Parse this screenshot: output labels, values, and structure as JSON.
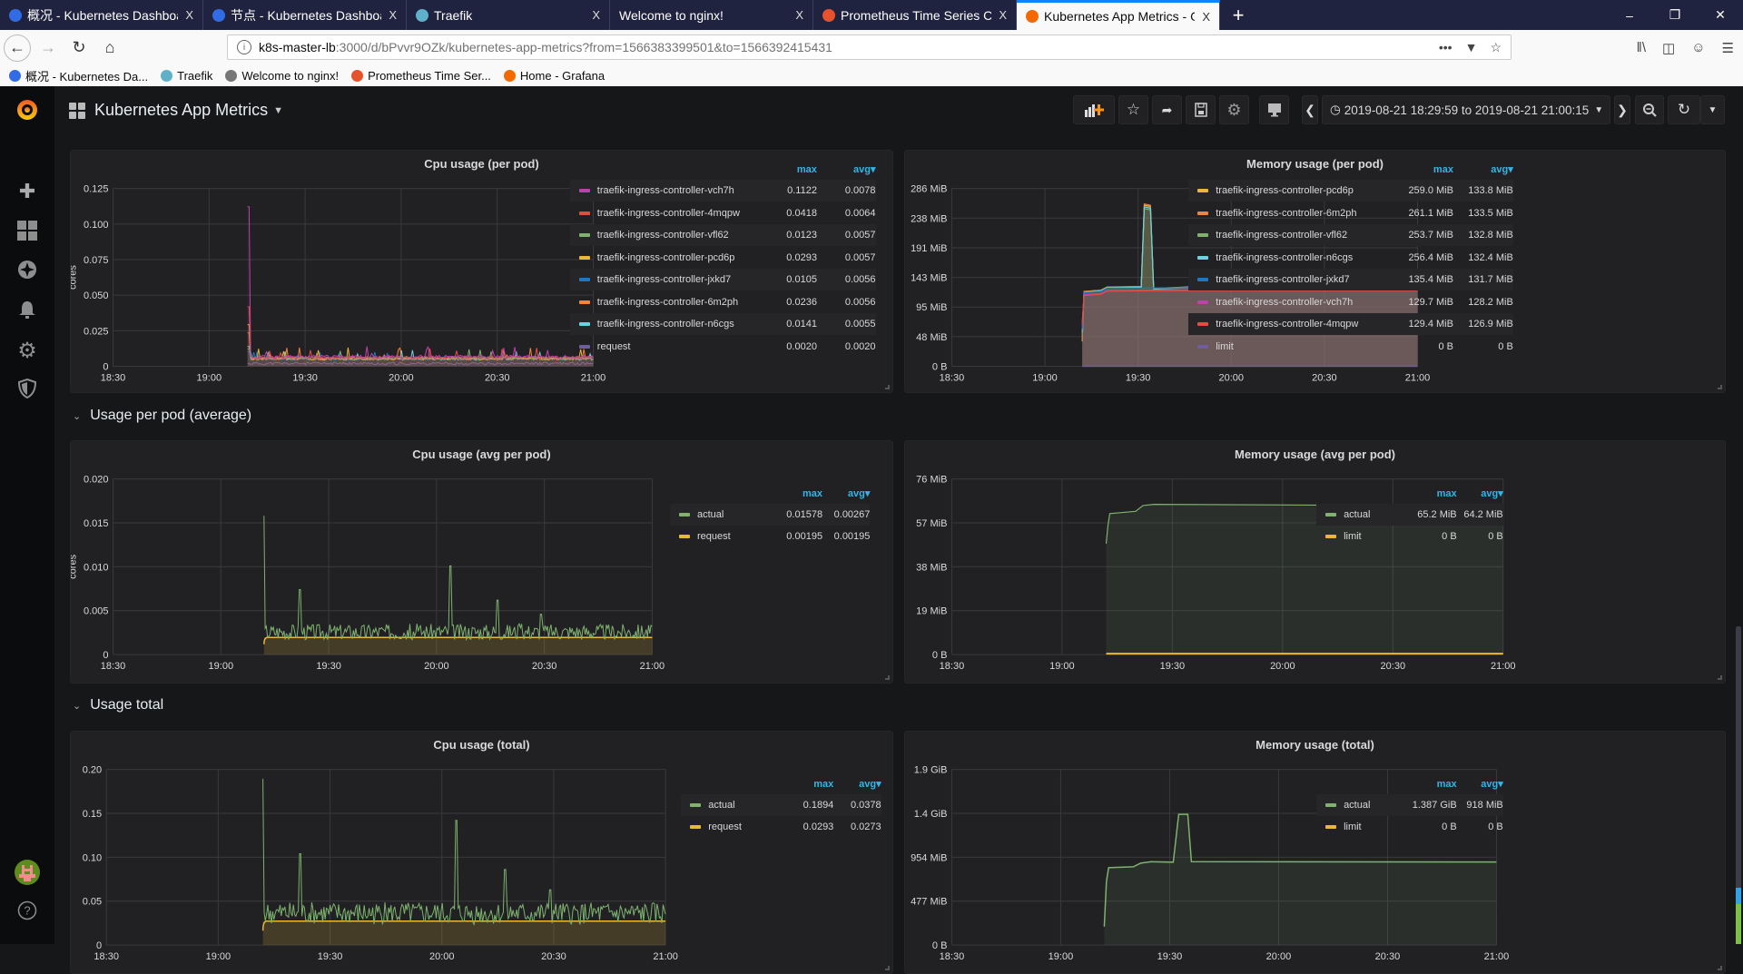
{
  "browser": {
    "tabs": [
      {
        "label": "概况 - Kubernetes Dashboard",
        "icon": "kubernetes-icon",
        "color": "#326ce5",
        "active": false
      },
      {
        "label": "节点 - Kubernetes Dashboard",
        "icon": "kubernetes-icon",
        "color": "#326ce5",
        "active": false
      },
      {
        "label": "Traefik",
        "icon": "traefik-icon",
        "color": "#5fb0c9",
        "active": false
      },
      {
        "label": "Welcome to nginx!",
        "icon": "",
        "color": "",
        "active": false
      },
      {
        "label": "Prometheus Time Series Collection",
        "icon": "prometheus-icon",
        "color": "#e6522c",
        "active": false
      },
      {
        "label": "Kubernetes App Metrics - Grafana",
        "icon": "grafana-icon",
        "color": "#f46800",
        "active": true
      }
    ],
    "close_glyph": "X",
    "new_tab_glyph": "+",
    "url_host": "k8s-master-lb",
    "url_path": ":3000/d/bPvvr9OZk/kubernetes-app-metrics?from=1566383399501&to=1566392415431",
    "bookmarks": [
      {
        "label": "概况 - Kubernetes Da...",
        "color": "#326ce5"
      },
      {
        "label": "Traefik",
        "color": "#5fb0c9"
      },
      {
        "label": "Welcome to nginx!",
        "color": "#777"
      },
      {
        "label": "Prometheus Time Ser...",
        "color": "#e6522c"
      },
      {
        "label": "Home - Grafana",
        "color": "#f46800"
      }
    ]
  },
  "grafana": {
    "dashboard_title": "Kubernetes App Metrics",
    "time_range": "2019-08-21 18:29:59 to 2019-08-21 21:00:15",
    "colors": {
      "accent": "#33b5e5",
      "background": "#161719",
      "panel": "#212124"
    },
    "sidebar": [
      "create-icon",
      "dashboards-icon",
      "explore-icon",
      "alerting-icon",
      "configuration-icon",
      "server-admin-icon"
    ],
    "rows": [
      {
        "title": "Usage per pod (average)"
      },
      {
        "title": "Usage total"
      }
    ],
    "legend_headers": {
      "max": "max",
      "avg": "avg"
    }
  },
  "chart_data": [
    {
      "id": "cpu_per_pod",
      "type": "line",
      "title": "Cpu usage (per pod)",
      "ylabel": "cores",
      "xticks": [
        "18:30",
        "19:00",
        "19:30",
        "20:00",
        "20:30",
        "21:00"
      ],
      "yticks": [
        "0",
        "0.025",
        "0.050",
        "0.075",
        "0.100",
        "0.125"
      ],
      "ylim": [
        0,
        0.125
      ],
      "xlim_minutes": [
        0,
        150
      ],
      "data_start_minute": 42,
      "series": [
        {
          "name": "traefik-ingress-controller-vch7h",
          "color": "#ba43a9",
          "max": "0.1122",
          "avg": "0.0078",
          "peak": 0.1122,
          "base": 0.0068
        },
        {
          "name": "traefik-ingress-controller-4mqpw",
          "color": "#e24d42",
          "max": "0.0418",
          "avg": "0.0064",
          "peak": 0.0418,
          "base": 0.0062
        },
        {
          "name": "traefik-ingress-controller-vfl62",
          "color": "#7eb26d",
          "max": "0.0123",
          "avg": "0.0057",
          "peak": 0.0123,
          "base": 0.0055
        },
        {
          "name": "traefik-ingress-controller-pcd6p",
          "color": "#eab839",
          "max": "0.0293",
          "avg": "0.0057",
          "peak": 0.0293,
          "base": 0.0055
        },
        {
          "name": "traefik-ingress-controller-jxkd7",
          "color": "#1f78c1",
          "max": "0.0105",
          "avg": "0.0056",
          "peak": 0.0105,
          "base": 0.0054
        },
        {
          "name": "traefik-ingress-controller-6m2ph",
          "color": "#ef843c",
          "max": "0.0236",
          "avg": "0.0056",
          "peak": 0.0236,
          "base": 0.0054
        },
        {
          "name": "traefik-ingress-controller-n6cgs",
          "color": "#6ed0e0",
          "max": "0.0141",
          "avg": "0.0055",
          "peak": 0.0141,
          "base": 0.0053
        },
        {
          "name": "request",
          "color": "#705da0",
          "max": "0.0020",
          "avg": "0.0020",
          "peak": 0.002,
          "base": 0.002
        }
      ]
    },
    {
      "id": "mem_per_pod",
      "type": "area",
      "title": "Memory usage (per pod)",
      "ylabel": "",
      "xticks": [
        "18:30",
        "19:00",
        "19:30",
        "20:00",
        "20:30",
        "21:00"
      ],
      "yticks": [
        "0 B",
        "48 MiB",
        "95 MiB",
        "143 MiB",
        "191 MiB",
        "238 MiB",
        "286 MiB"
      ],
      "ylim": [
        0,
        286
      ],
      "xlim_minutes": [
        0,
        150
      ],
      "data_start_minute": 42,
      "series": [
        {
          "name": "traefik-ingress-controller-pcd6p",
          "color": "#eab839",
          "max": "259.0 MiB",
          "avg": "133.8 MiB"
        },
        {
          "name": "traefik-ingress-controller-6m2ph",
          "color": "#ef843c",
          "max": "261.1 MiB",
          "avg": "133.5 MiB"
        },
        {
          "name": "traefik-ingress-controller-vfl62",
          "color": "#7eb26d",
          "max": "253.7 MiB",
          "avg": "132.8 MiB"
        },
        {
          "name": "traefik-ingress-controller-n6cgs",
          "color": "#6ed0e0",
          "max": "256.4 MiB",
          "avg": "132.4 MiB"
        },
        {
          "name": "traefik-ingress-controller-jxkd7",
          "color": "#1f78c1",
          "max": "135.4 MiB",
          "avg": "131.7 MiB"
        },
        {
          "name": "traefik-ingress-controller-vch7h",
          "color": "#ba43a9",
          "max": "129.7 MiB",
          "avg": "128.2 MiB"
        },
        {
          "name": "traefik-ingress-controller-4mqpw",
          "color": "#e24d42",
          "max": "129.4 MiB",
          "avg": "126.9 MiB"
        },
        {
          "name": "limit",
          "color": "#705da0",
          "max": "0 B",
          "avg": "0 B"
        }
      ]
    },
    {
      "id": "cpu_avg",
      "type": "line",
      "title": "Cpu usage (avg per pod)",
      "ylabel": "cores",
      "xticks": [
        "18:30",
        "19:00",
        "19:30",
        "20:00",
        "20:30",
        "21:00"
      ],
      "yticks": [
        "0",
        "0.005",
        "0.010",
        "0.015",
        "0.020"
      ],
      "ylim": [
        0,
        0.02
      ],
      "xlim_minutes": [
        0,
        150
      ],
      "data_start_minute": 42,
      "spikes": [
        [
          42,
          0.0158
        ],
        [
          52,
          0.0074
        ],
        [
          94,
          0.0101
        ],
        [
          107,
          0.0062
        ],
        [
          119,
          0.0046
        ]
      ],
      "series": [
        {
          "name": "actual",
          "color": "#7eb26d",
          "max": "0.01578",
          "avg": "0.00267",
          "base": 0.0026
        },
        {
          "name": "request",
          "color": "#eab839",
          "max": "0.00195",
          "avg": "0.00195",
          "base": 0.00195
        }
      ]
    },
    {
      "id": "mem_avg",
      "type": "area",
      "title": "Memory usage (avg per pod)",
      "ylabel": "",
      "xticks": [
        "18:30",
        "19:00",
        "19:30",
        "20:00",
        "20:30",
        "21:00"
      ],
      "yticks": [
        "0 B",
        "19 MiB",
        "38 MiB",
        "57 MiB",
        "76 MiB"
      ],
      "ylim": [
        0,
        76
      ],
      "xlim_minutes": [
        0,
        150
      ],
      "data_start_minute": 42,
      "series": [
        {
          "name": "actual",
          "color": "#7eb26d",
          "max": "65.2 MiB",
          "avg": "64.2 MiB",
          "level": 64.2
        },
        {
          "name": "limit",
          "color": "#eab839",
          "max": "0 B",
          "avg": "0 B",
          "level": 0
        }
      ]
    },
    {
      "id": "cpu_total",
      "type": "line",
      "title": "Cpu usage (total)",
      "ylabel": "cores",
      "xticks": [
        "18:30",
        "19:00",
        "19:30",
        "20:00",
        "20:30",
        "21:00"
      ],
      "yticks": [
        "0",
        "0.05",
        "0.10",
        "0.15",
        "0.20"
      ],
      "ylim": [
        0,
        0.2
      ],
      "xlim_minutes": [
        0,
        150
      ],
      "data_start_minute": 42,
      "spikes": [
        [
          42,
          0.1894
        ],
        [
          52,
          0.104
        ],
        [
          94,
          0.142
        ],
        [
          107,
          0.086
        ],
        [
          119,
          0.063
        ]
      ],
      "series": [
        {
          "name": "actual",
          "color": "#7eb26d",
          "max": "0.1894",
          "avg": "0.0378",
          "base": 0.036
        },
        {
          "name": "request",
          "color": "#eab839",
          "max": "0.0293",
          "avg": "0.0273",
          "base": 0.0273
        }
      ]
    },
    {
      "id": "mem_total",
      "type": "area",
      "title": "Memory usage (total)",
      "ylabel": "",
      "xticks": [
        "18:30",
        "19:00",
        "19:30",
        "20:00",
        "20:30",
        "21:00"
      ],
      "yticks": [
        "0 B",
        "477 MiB",
        "954 MiB",
        "1.4 GiB",
        "1.9 GiB"
      ],
      "ylim_mib": [
        0,
        1908
      ],
      "xlim_minutes": [
        0,
        150
      ],
      "data_start_minute": 42,
      "series": [
        {
          "name": "actual",
          "color": "#7eb26d",
          "max": "1.387 GiB",
          "avg": "918 MiB",
          "level_mib": 905,
          "peak_mib": 1420
        },
        {
          "name": "limit",
          "color": "#eab839",
          "max": "0 B",
          "avg": "0 B",
          "level_mib": 0
        }
      ]
    }
  ]
}
